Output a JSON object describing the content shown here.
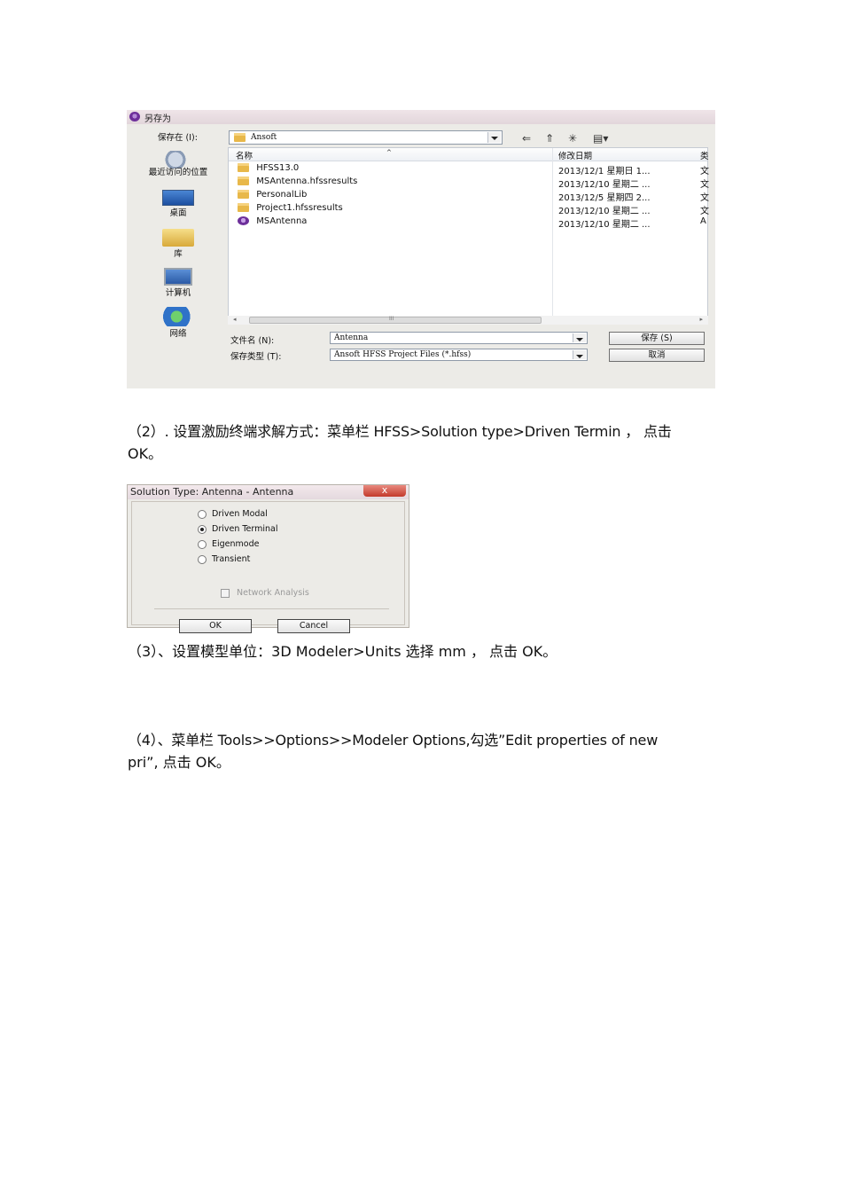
{
  "save_dialog": {
    "title": "另存为",
    "save_in_label": "保存在 (I):",
    "current_folder": "Ansoft",
    "places": [
      "最近访问的位置",
      "桌面",
      "库",
      "计算机",
      "网络"
    ],
    "columns": {
      "name": "名称",
      "date": "修改日期"
    },
    "files": [
      {
        "name": "HFSS13.0",
        "date": "2013/12/1 星期日 1...",
        "type": "文",
        "icon": "folder-icon"
      },
      {
        "name": "MSAntenna.hfssresults",
        "date": "2013/12/10 星期二 ...",
        "type": "文",
        "icon": "folder-icon"
      },
      {
        "name": "PersonalLib",
        "date": "2013/12/5 星期四 2...",
        "type": "文",
        "icon": "folder-icon"
      },
      {
        "name": "Project1.hfssresults",
        "date": "2013/12/10 星期二 ...",
        "type": "文",
        "icon": "folder-icon"
      },
      {
        "name": "MSAntenna",
        "date": "2013/12/10 星期二 ...",
        "type": "A",
        "icon": "hfss-app-icon"
      }
    ],
    "filename_label": "文件名 (N):",
    "filename_value": "Antenna",
    "filetype_label": "保存类型 (T):",
    "filetype_value": "Ansoft HFSS Project Files (*.hfss)",
    "save_button": "保存 (S)",
    "cancel_button": "取消",
    "scroll_grip": "III"
  },
  "step2": {
    "line1": "（2）. 设置激励终端求解方式：菜单栏 HFSS>Solution type>Driven Termin ，  点击",
    "line2": "OK。"
  },
  "solution_dialog": {
    "title": "Solution Type: Antenna - Antenna",
    "close": "x",
    "options": [
      "Driven Modal",
      "Driven Terminal",
      "Eigenmode",
      "Transient"
    ],
    "selected": "Driven Terminal",
    "network_analysis": "Network Analysis",
    "ok": "OK",
    "cancel": "Cancel"
  },
  "step3": {
    "line1": "（3）、设置模型单位：3D Modeler>Units 选择 mm ， 点击 OK。"
  },
  "step4": {
    "line1": "（4）、菜单栏 Tools>>Options>>Modeler Options,勾选”Edit properties of new",
    "line2": "pri”, 点击 OK。"
  }
}
